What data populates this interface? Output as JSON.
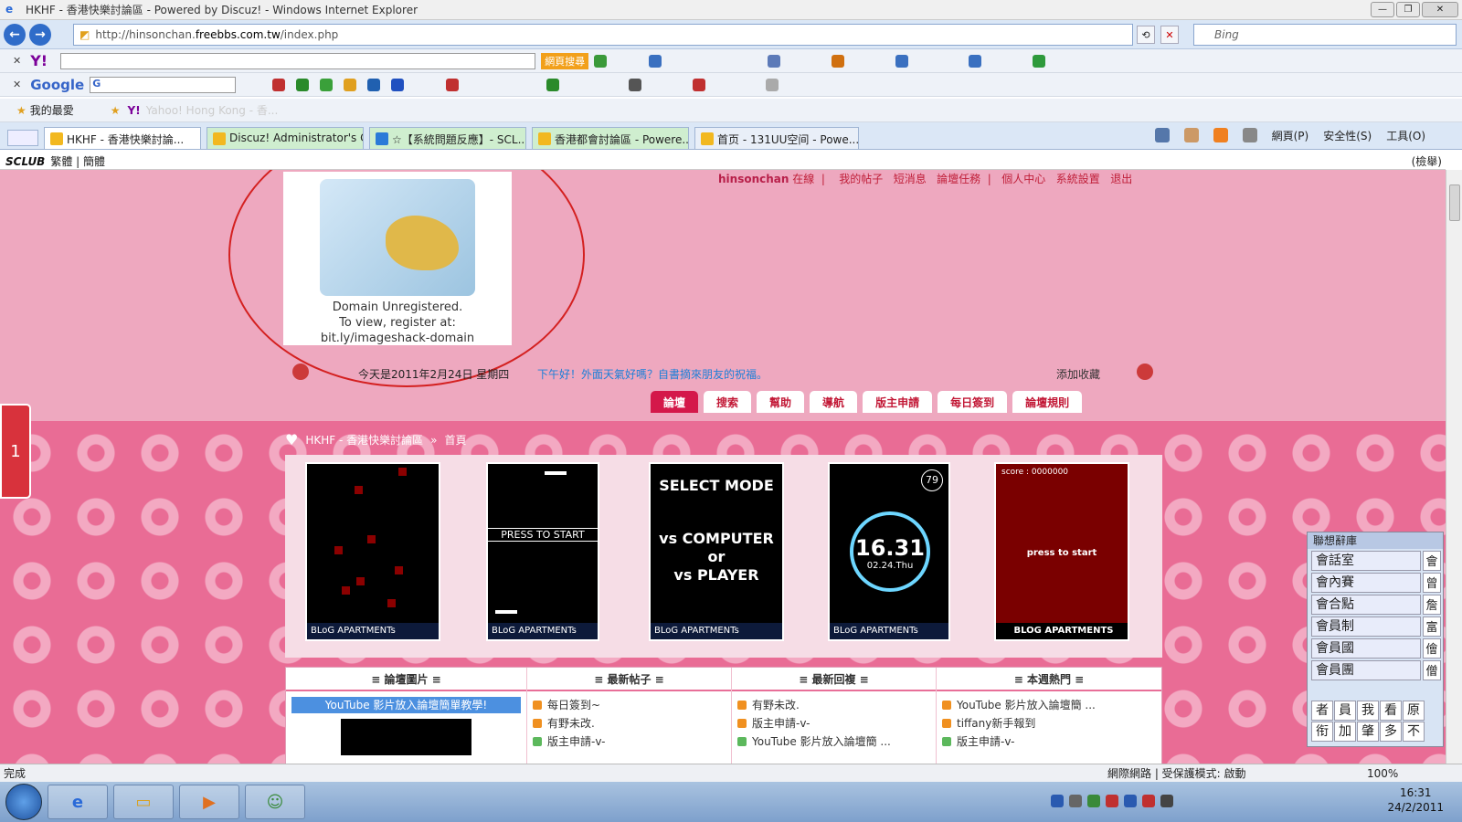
{
  "window": {
    "title": "HKHF - 香港快樂討論區 - Powered by Discuz! - Windows Internet Explorer",
    "url_prefix": "http://hinsonchan.",
    "url_host": "freebbs.com.tw",
    "url_path": "/index.php",
    "search_placeholder": "Bing"
  },
  "toolbars": {
    "yahoo_logo": "Y!",
    "yahoo_button": "網頁搜尋",
    "google_logo": "Google",
    "google_field": "G",
    "favorites_label": "我的最愛",
    "yahoo_hk": "Yahoo! Hong Kong - 香..."
  },
  "tabs": [
    {
      "label": "HKHF - 香港快樂討論...",
      "color": "#f2b820"
    },
    {
      "label": "Discuz! Administrator's C...",
      "color": "#f2b820"
    },
    {
      "label": "☆【系統問題反應】- SCL...",
      "color": "#2a7ad8"
    },
    {
      "label": "香港都會討論區 - Powere...",
      "color": "#f2b820"
    },
    {
      "label": "首页 - 131UU空间 - Powe...",
      "color": "#f2b820"
    }
  ],
  "commandbar": {
    "page": "網頁(P)",
    "safety": "安全性(S)",
    "tools": "工具(O)"
  },
  "sclub": {
    "logo": "SCLUB",
    "trad": "繁體",
    "simp": "簡體",
    "report": "(檢舉)"
  },
  "header": {
    "logo_line1": "Domain Unregistered.",
    "logo_line2": "To view, register at:",
    "logo_line3": "bit.ly/imageshack-domain",
    "username": "hinsonchan",
    "status": "在線",
    "nav": [
      "我的帖子",
      "短消息",
      "論壇任務",
      "個人中心",
      "系統設置",
      "退出"
    ],
    "date": "今天是2011年2月24日 星期四",
    "greeting": "下午好！外面天氣好嗎？自書摘來朋友的祝福。",
    "bookmark": "添加收藏"
  },
  "menu_tabs": [
    "論壇",
    "搜索",
    "幫助",
    "導航",
    "版主申請",
    "每日簽到",
    "論壇規則"
  ],
  "breadcrumb": {
    "site": "HKHF - 香港快樂討論區",
    "sep": "»",
    "page": "首頁"
  },
  "games": {
    "footer": "BLoG APARTMENTs",
    "footer_caps": "BLOG APARTMENTS",
    "press_start": "PRESS TO START",
    "select_mode": "SELECT MODE",
    "vs_computer": "vs COMPUTER",
    "or": "or",
    "vs_player": "vs PLAYER",
    "clock_time": "16.31",
    "clock_date": "02.24.Thu",
    "clock_badge": "79",
    "score_label": "score : 0000000",
    "press_to_start": "press to start"
  },
  "boxes": {
    "pictures": {
      "title": "≡ 論壇圖片 ≡",
      "banner": "YouTube 影片放入論壇簡單教學!"
    },
    "new_posts": {
      "title": "≡ 最新帖子 ≡",
      "items": [
        "每日簽到~",
        "有野未改.",
        "版主申請-v-"
      ]
    },
    "new_replies": {
      "title": "≡ 最新回複 ≡",
      "items": [
        "有野未改.",
        "版主申請-v-",
        "YouTube 影片放入論壇簡 ..."
      ]
    },
    "weekly_hot": {
      "title": "≡ 本週熱門 ≡",
      "items": [
        "YouTube 影片放入論壇簡 ...",
        "tiffany新手報到",
        "版主申請-v-"
      ]
    }
  },
  "ime": {
    "title": "聯想辭庫",
    "candidates": [
      "會話室",
      "會內賽",
      "會合點",
      "會員制",
      "會員國",
      "會員團"
    ],
    "grid": [
      "者",
      "員",
      "我",
      "看",
      "原",
      "衔",
      "加",
      "肇",
      "多",
      "不"
    ],
    "side": [
      "會",
      "曾",
      "詹",
      "富",
      "儈",
      "僧"
    ]
  },
  "statusbar": {
    "done": "完成",
    "zone": "網際網路 | 受保護模式: 啟動",
    "zoom": "100%"
  },
  "taskbar": {
    "time": "16:31",
    "date": "24/2/2011"
  }
}
